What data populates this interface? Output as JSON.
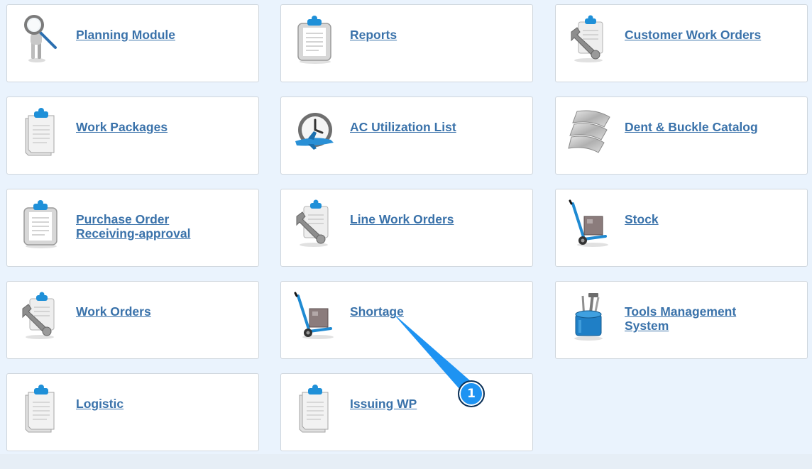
{
  "tiles": [
    {
      "label": "Planning Module",
      "icon": "magnifier-person-icon"
    },
    {
      "label": "Reports",
      "icon": "clipboard-icon"
    },
    {
      "label": "Customer Work Orders",
      "icon": "wrench-clipboard-icon"
    },
    {
      "label": "Work Packages",
      "icon": "documents-clipboard-icon"
    },
    {
      "label": "AC Utilization List",
      "icon": "clock-airplane-icon"
    },
    {
      "label": "Dent & Buckle Catalog",
      "icon": "metal-sheets-icon"
    },
    {
      "label": "Purchase Order Receiving-approval",
      "icon": "clipboard-icon"
    },
    {
      "label": "Line Work Orders",
      "icon": "wrench-clipboard-icon"
    },
    {
      "label": "Stock",
      "icon": "hand-truck-icon"
    },
    {
      "label": "Work Orders",
      "icon": "wrench-clipboard-icon"
    },
    {
      "label": "Shortage",
      "icon": "hand-truck-icon"
    },
    {
      "label": "Tools Management System",
      "icon": "toolbox-icon"
    },
    {
      "label": "Logistic",
      "icon": "documents-clipboard-icon"
    },
    {
      "label": "Issuing WP",
      "icon": "documents-clipboard-icon"
    }
  ],
  "annotation": {
    "badge_number": "1",
    "target": "Shortage"
  },
  "colors": {
    "link": "#3a72aa",
    "background": "#eaf3fd",
    "tile_border": "#cfd6dd",
    "callout": "#1e93f2"
  }
}
